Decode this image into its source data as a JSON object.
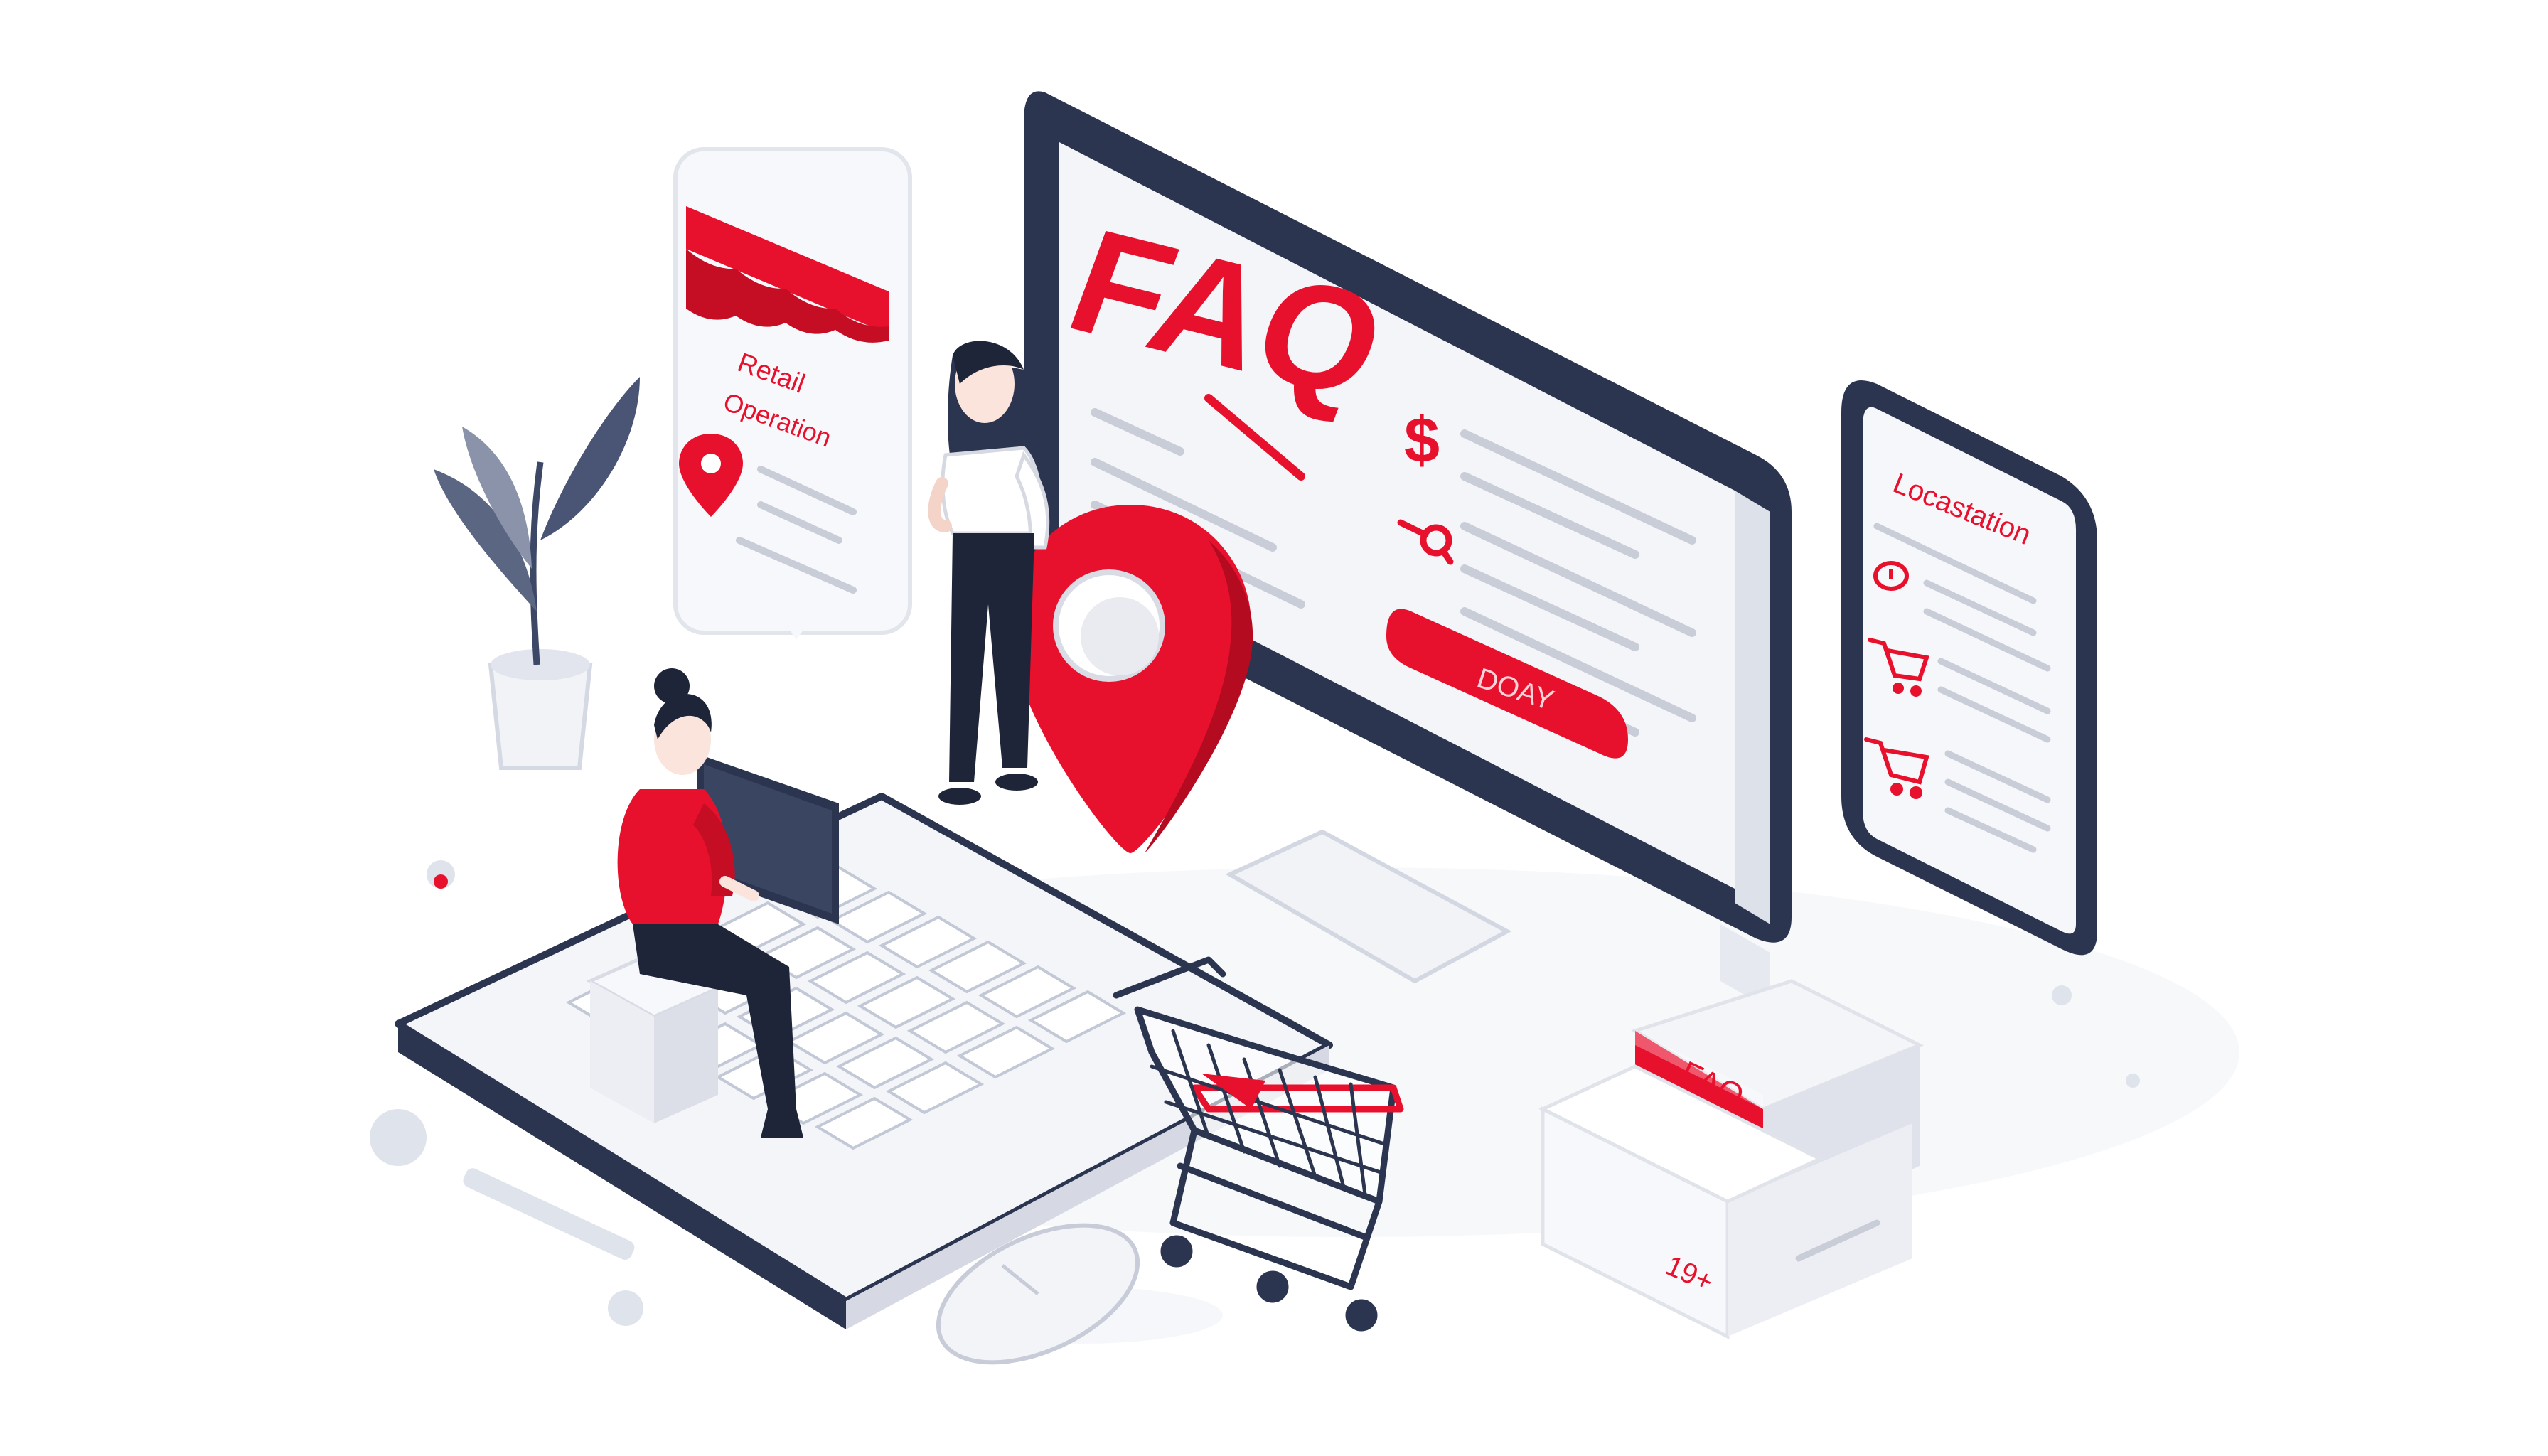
{
  "colors": {
    "accent": "#e8112d",
    "dark": "#2b3550",
    "steel": "#5b6682",
    "light": "#eef0f5",
    "line": "#c9cdd8",
    "background": "#ffffff"
  },
  "monitor": {
    "title": "FAQ",
    "symbol_top": "$",
    "button_label": "DOAY"
  },
  "store_card": {
    "line1": "Retail",
    "line2": "Operation"
  },
  "phone": {
    "title": "Locastation"
  },
  "box": {
    "label": "FAQ",
    "marking": "19+"
  },
  "icons": [
    "plant",
    "person-sitting",
    "person-standing",
    "location-pin-icon",
    "shopping-cart-icon",
    "mouse",
    "keyboard",
    "storefront-awning",
    "box"
  ]
}
